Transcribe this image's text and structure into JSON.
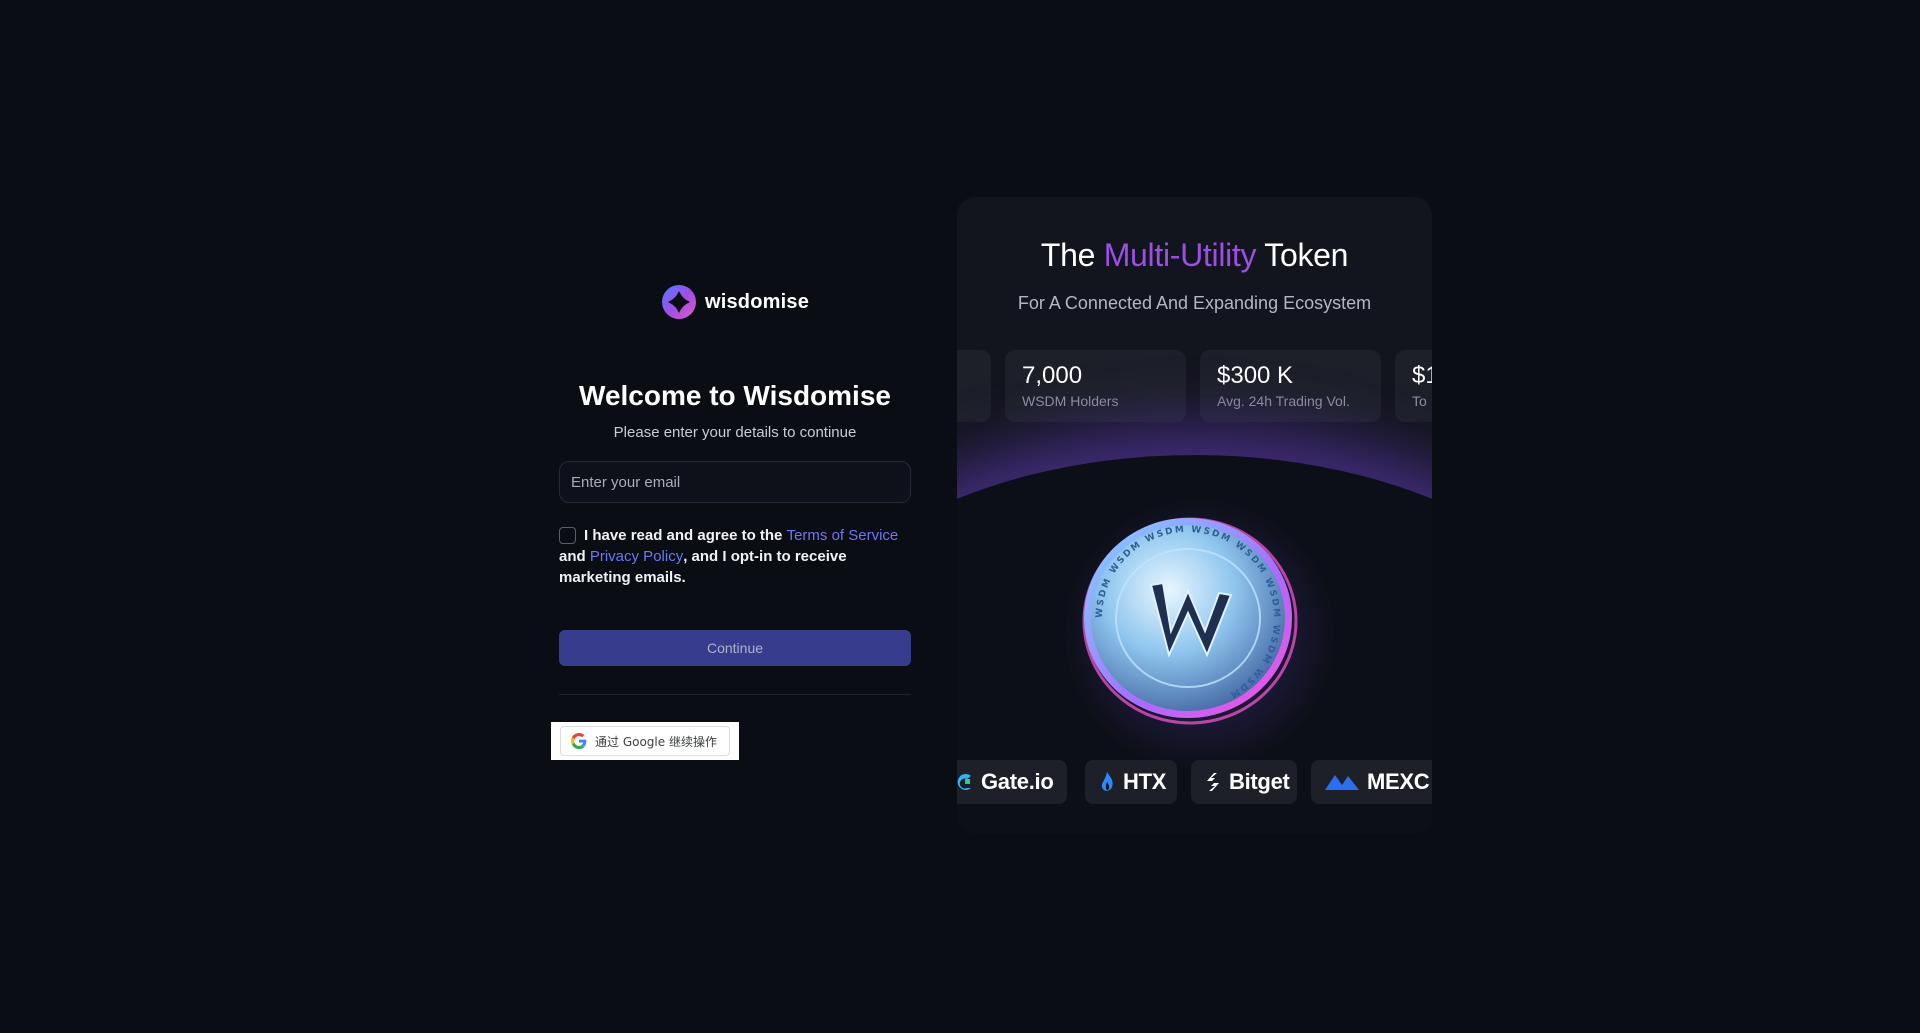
{
  "brand": {
    "name": "wisdomise"
  },
  "login": {
    "title": "Welcome to Wisdomise",
    "subtitle": "Please enter your details to continue",
    "email_placeholder": "Enter your email",
    "agree": {
      "text_before": "I have read and agree to the ",
      "terms_link": "Terms of Service",
      "and_text": "and ",
      "privacy_link": "Privacy Policy",
      "text_after": ", and I opt-in to receive marketing emails."
    },
    "continue_label": "Continue",
    "google_label": "通过 Google 继续操作"
  },
  "promo": {
    "title_prefix": "The ",
    "title_accent": "Multi-Utility",
    "title_suffix": " Token",
    "subtitle": "For A Connected And Expanding Ecosystem",
    "stats": [
      {
        "value": "7,000",
        "label": "WSDM Holders"
      },
      {
        "value": "$300 K",
        "label": "Avg. 24h Trading Vol."
      },
      {
        "value": "$1",
        "label": "To"
      }
    ],
    "coin_ring_text": "WSDM",
    "exchanges": [
      "Gate.io",
      "HTX",
      "Bitget",
      "MEXC"
    ]
  },
  "colors": {
    "background": "#0b0d14",
    "accent_purple": "#9b4fe4",
    "link": "#6b78f0",
    "continue_button": "#383c8c"
  }
}
